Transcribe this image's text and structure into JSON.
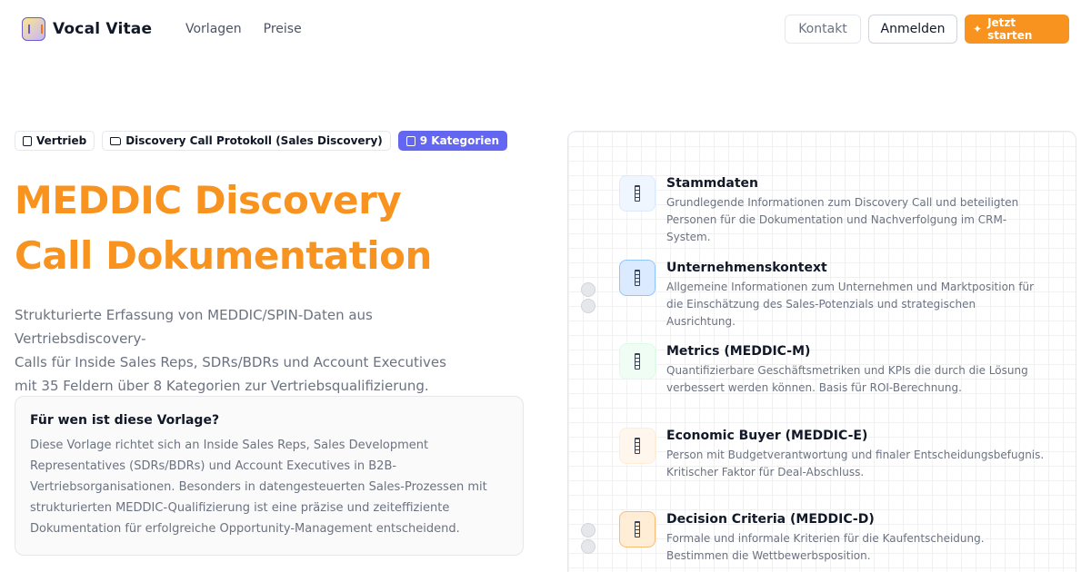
{
  "brand": {
    "name": "Vocal Vitae"
  },
  "nav": {
    "items": [
      "Vorlagen",
      "Preise"
    ]
  },
  "header_buttons": {
    "kontakt": "Kontakt",
    "anmelden": "Anmelden",
    "start": "Jetzt starten"
  },
  "badges": {
    "category": "Vertrieb",
    "template": "Discovery Call Protokoll (Sales Discovery)",
    "count": "9 Kategorien"
  },
  "hero": {
    "title_line1": "MEDDIC Discovery",
    "title_line2": "Call Dokumentation",
    "subtitle_line1": "Strukturierte Erfassung von MEDDIC/SPIN-Daten aus Vertriebsdiscovery-",
    "subtitle_line2": "Calls für Inside Sales Reps, SDRs/BDRs und Account Executives",
    "subtitle_line3": "mit 35 Feldern über 8 Kategorien zur Vertriebsqualifizierung."
  },
  "audience": {
    "title": "Für wen ist diese Vorlage?",
    "text": "Diese Vorlage richtet sich an Inside Sales Reps, Sales Development Representatives (SDRs/BDRs) und Account Executives in B2B-Vertriebsorganisationen. Besonders in datengesteuerten Sales-Prozessen mit strukturierten MEDDIC-Qualifizierung ist eine präzise und zeiteffiziente Dokumentation für erfolgreiche Opportunity-Management entscheidend."
  },
  "categories": [
    {
      "title": "Stammdaten",
      "desc": "Grundlegende Informationen zum Discovery Call und beteiligten Personen für die Dokumentation und Nachverfolgung im CRM-System.",
      "icon": "document-icon",
      "bg": "#eff6ff",
      "border": "#dbeafe"
    },
    {
      "title": "Unternehmenskontext",
      "desc": "Allgemeine Informationen zum Unternehmen und Marktposition für die Einschätzung des Sales-Potenzials und strategischen Ausrichtung.",
      "icon": "document-icon",
      "bg": "#dbeafe",
      "border": "#93c5fd"
    },
    {
      "title": "Metrics (MEDDIC-M)",
      "desc": "Quantifizierbare Geschäftsmetriken und KPIs die durch die Lösung verbessert werden können. Basis für ROI-Berechnung.",
      "icon": "document-icon",
      "bg": "#f0fdf4",
      "border": "#dcfce7"
    },
    {
      "title": "Economic Buyer (MEDDIC-E)",
      "desc": "Person mit Budgetverantwortung und finaler Entscheidungsbefugnis. Kritischer Faktor für Deal-Abschluss.",
      "icon": "document-icon",
      "bg": "#fff7ed",
      "border": "#ffedd5"
    },
    {
      "title": "Decision Criteria (MEDDIC-D)",
      "desc": "Formale und informale Kriterien für die Kaufentscheidung. Bestimmen die Wettbewerbsposition.",
      "icon": "document-icon",
      "bg": "#ffedd5",
      "border": "#fdba74"
    }
  ]
}
